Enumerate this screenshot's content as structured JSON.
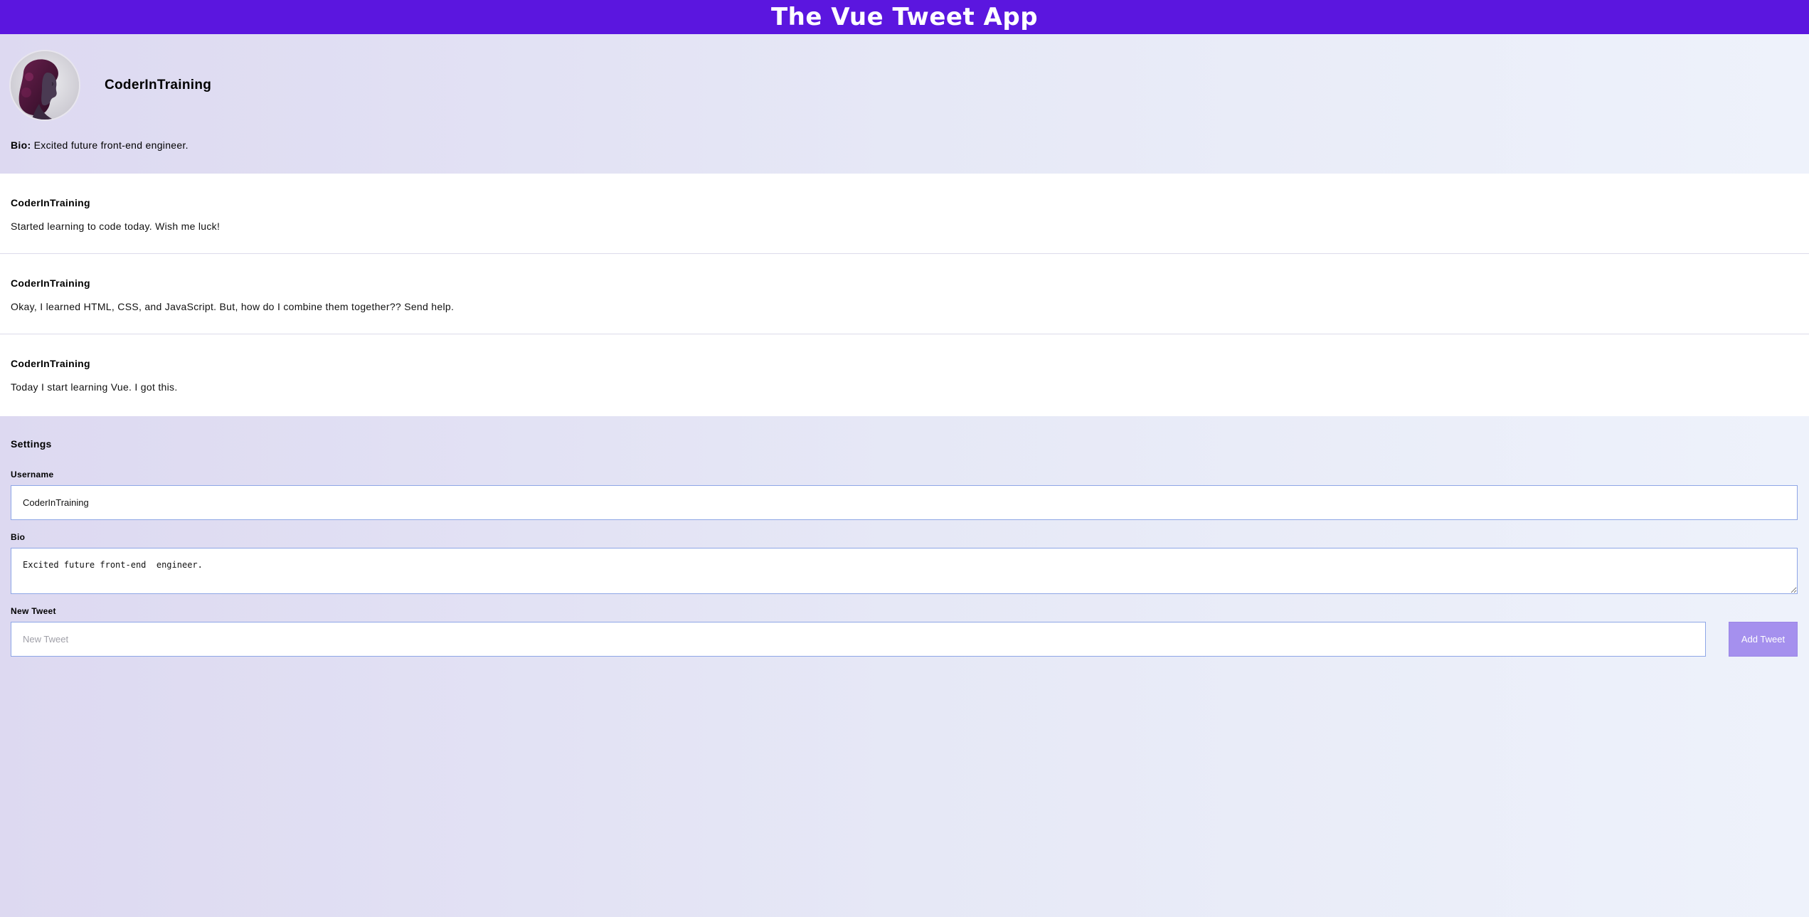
{
  "header": {
    "title": "The Vue Tweet App"
  },
  "profile": {
    "avatar_icon": "avatar-portrait",
    "username": "CoderInTraining",
    "bio_label": "Bio:",
    "bio_text": "Excited future front-end engineer."
  },
  "tweets": [
    {
      "author": "CoderInTraining",
      "body": "Started learning to code today. Wish me luck!"
    },
    {
      "author": "CoderInTraining",
      "body": "Okay, I learned HTML, CSS, and JavaScript. But, how do I combine them together?? Send help."
    },
    {
      "author": "CoderInTraining",
      "body": "Today I start learning Vue. I got this."
    }
  ],
  "settings": {
    "title": "Settings",
    "username_label": "Username",
    "username_value": "CoderInTraining",
    "bio_label": "Bio",
    "bio_value": "Excited future front-end  engineer.",
    "new_tweet_label": "New Tweet",
    "new_tweet_placeholder": "New Tweet",
    "add_button_label": "Add Tweet"
  },
  "colors": {
    "header_bg": "#5b16df",
    "button_bg": "#a590ee",
    "input_border": "#8ea6e6"
  }
}
